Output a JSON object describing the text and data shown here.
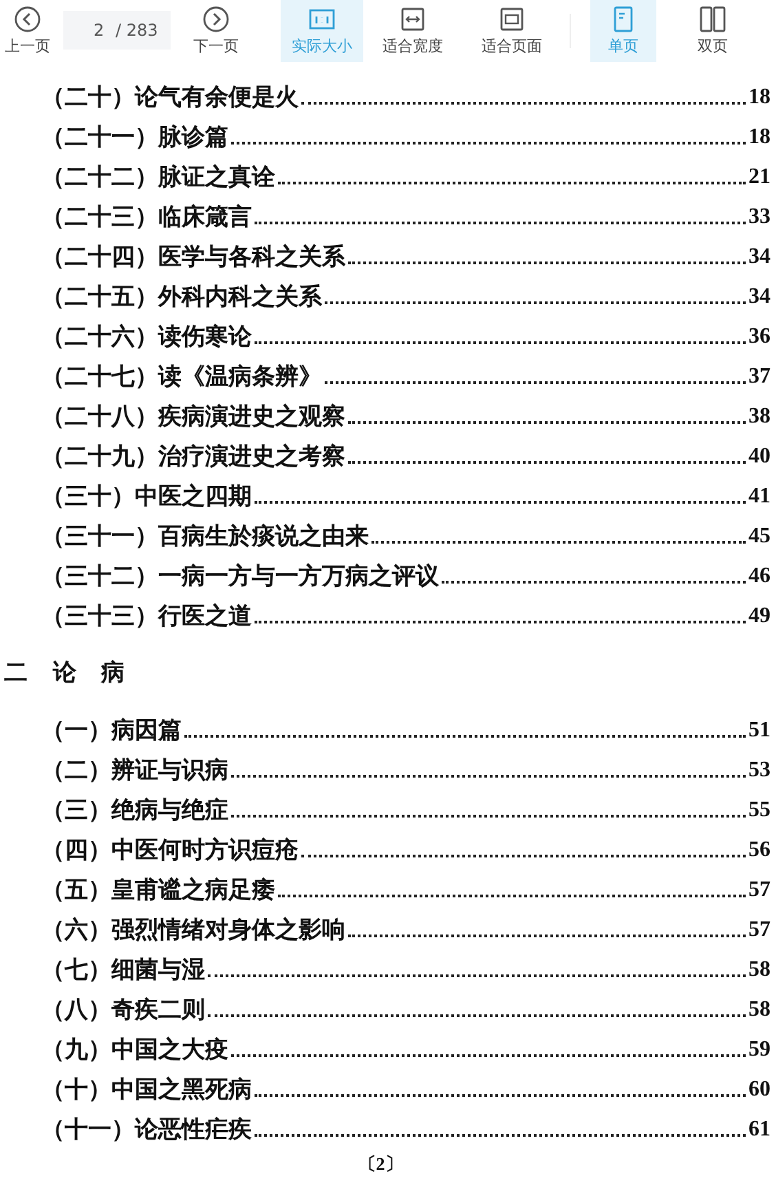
{
  "toolbar": [
    {
      "kind": "prev",
      "label": "上一页"
    },
    {
      "kind": "page",
      "value": "2",
      "total": "/ 283"
    },
    {
      "kind": "next",
      "label": "下一页"
    },
    {
      "kind": "actual",
      "label": "实际大小",
      "selected": true
    },
    {
      "kind": "fitwidth",
      "label": "适合宽度",
      "selected": false
    },
    {
      "kind": "fitpage",
      "label": "适合页面",
      "selected": false
    },
    {
      "kind": "single",
      "label": "单页",
      "selected": true
    },
    {
      "kind": "double",
      "label": "双页",
      "selected": false
    }
  ],
  "sections": [
    {
      "entries": [
        {
          "title": "（二十）论气有余便是火",
          "page": "18"
        },
        {
          "title": "（二十一）脉诊篇",
          "page": "18"
        },
        {
          "title": "（二十二）脉证之真诠",
          "page": "21"
        },
        {
          "title": "（二十三）临床箴言",
          "page": "33"
        },
        {
          "title": "（二十四）医学与各科之关系",
          "page": "34"
        },
        {
          "title": "（二十五）外科内科之关系",
          "page": "34"
        },
        {
          "title": "（二十六）读伤寒论",
          "page": "36"
        },
        {
          "title": "（二十七）读《温病条辨》",
          "page": "37"
        },
        {
          "title": "（二十八）疾病演进史之观察",
          "page": "38"
        },
        {
          "title": "（二十九）治疗演进史之考察",
          "page": "40"
        },
        {
          "title": "（三十）中医之四期",
          "page": "41"
        },
        {
          "title": "（三十一）百病生於痰说之由来",
          "page": "45"
        },
        {
          "title": "（三十二）一病一方与一方万病之评议",
          "page": "46"
        },
        {
          "title": "（三十三）行医之道",
          "page": "49"
        }
      ]
    },
    {
      "heading": "二 论 病",
      "entries": [
        {
          "title": "（一）病因篇",
          "page": "51"
        },
        {
          "title": "（二）辨证与识病",
          "page": "53"
        },
        {
          "title": "（三）绝病与绝症",
          "page": "55"
        },
        {
          "title": "（四）中医何时方识痘疮",
          "page": "56"
        },
        {
          "title": "（五）皇甫谧之病足痿",
          "page": "57"
        },
        {
          "title": "（六）强烈情绪对身体之影响",
          "page": "57"
        },
        {
          "title": "（七）细菌与湿",
          "page": "58"
        },
        {
          "title": "（八）奇疾二则",
          "page": "58"
        },
        {
          "title": "（九）中国之大疫",
          "page": "59"
        },
        {
          "title": "（十）中国之黑死病",
          "page": "60"
        },
        {
          "title": "（十一）论恶性疟疾",
          "page": "61"
        }
      ]
    }
  ],
  "page_footer": "〔2〕"
}
